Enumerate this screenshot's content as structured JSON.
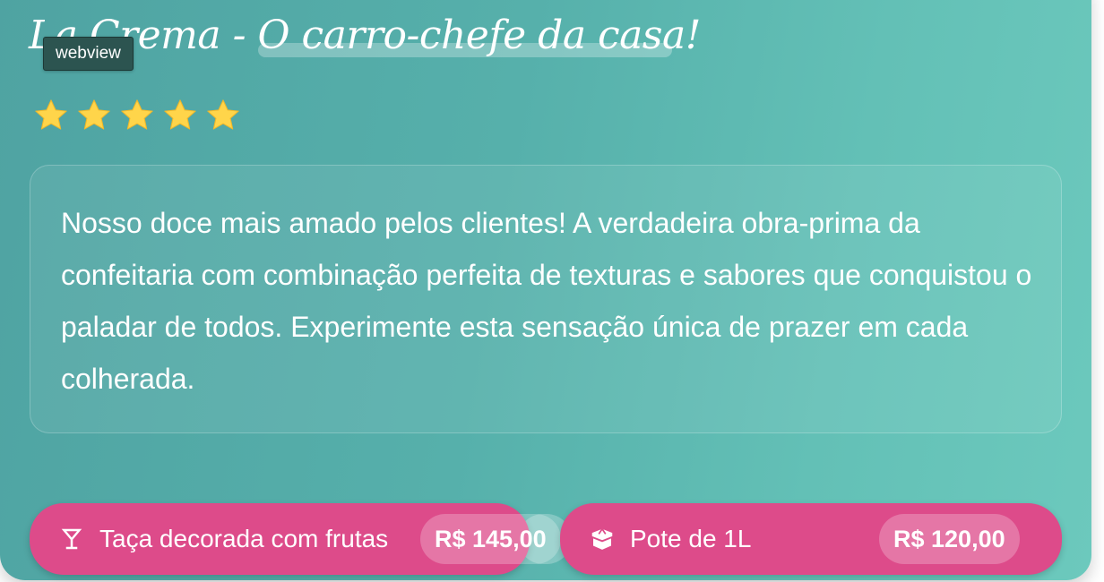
{
  "tag": {
    "label": "webview"
  },
  "product": {
    "title": "La Crema - O carro-chefe da casa!",
    "rating": 5,
    "rating_max": 5,
    "star_color": "#ffd54a",
    "description": "Nosso doce mais amado pelos clientes! A verdadeira obra-prima da confeitaria com combinação perfeita de texturas e sabores que conquistou o paladar de todos. Experimente esta sensação única de prazer em cada colherada."
  },
  "options": [
    {
      "label": "Taça decorada com frutas",
      "price": "R$ 145,00",
      "icon": "cocktail-glass-icon"
    },
    {
      "label": "Pote de 1L",
      "price": "R$ 120,00",
      "icon": "box-icon"
    }
  ],
  "colors": {
    "card_gradient_start": "#4fa3a2",
    "card_gradient_end": "#6cc9bd",
    "button": "#dd4b8a",
    "tag_bg": "#2c5450"
  }
}
